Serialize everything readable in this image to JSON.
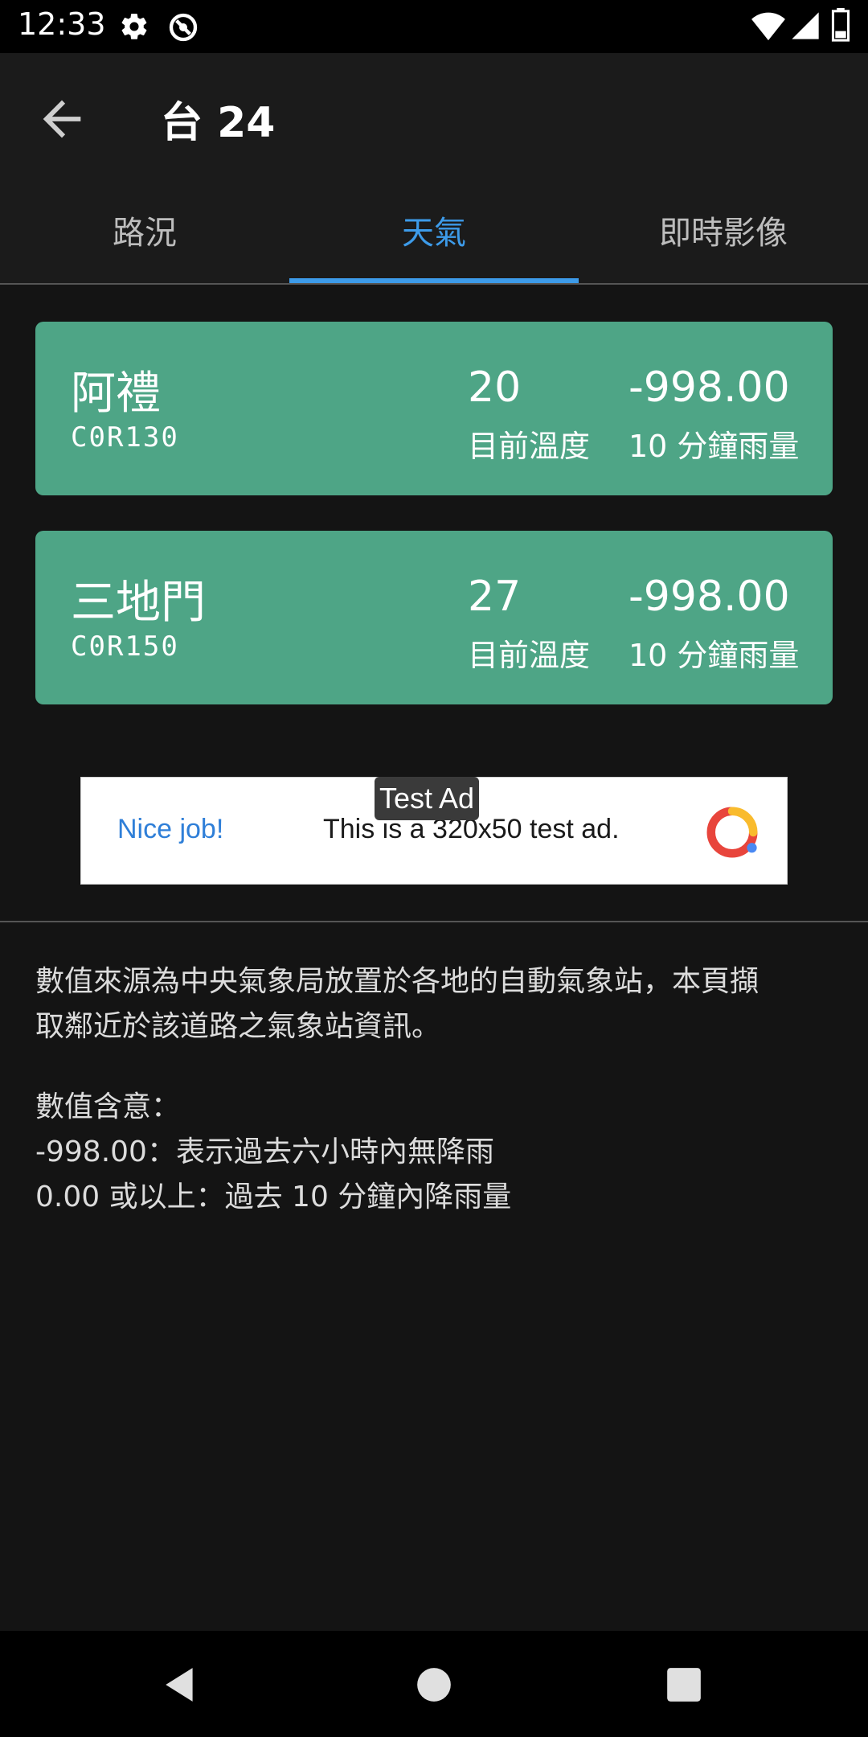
{
  "status_bar": {
    "time": "12:33",
    "icons": [
      "gear-icon",
      "vpn-icon",
      "wifi-icon",
      "signal-icon",
      "battery-icon"
    ]
  },
  "app_bar": {
    "title": "台 24",
    "back_icon": "arrow-back-icon"
  },
  "tabs": [
    {
      "label": "路況",
      "active": false
    },
    {
      "label": "天氣",
      "active": true
    },
    {
      "label": "即時影像",
      "active": false
    }
  ],
  "stations": [
    {
      "name": "阿禮",
      "id": "C0R130",
      "temp": "20",
      "temp_label": "目前溫度",
      "rain": "-998.00",
      "rain_label": "10 分鐘雨量"
    },
    {
      "name": "三地門",
      "id": "C0R150",
      "temp": "27",
      "temp_label": "目前溫度",
      "rain": "-998.00",
      "rain_label": "10 分鐘雨量"
    }
  ],
  "ad": {
    "badge": "Test Ad",
    "nice": "Nice job!",
    "text": "This is a 320x50 test ad."
  },
  "info": {
    "source_line1": "數值來源為中央氣象局放置於各地的自動氣象站，本頁擷",
    "source_line2": "取鄰近於該道路之氣象站資訊。",
    "meaning_title": "數值含意：",
    "meaning_1": "-998.00：表示過去六小時內無降雨",
    "meaning_2": "0.00 或以上：過去 10 分鐘內降雨量"
  },
  "nav_bar": {
    "icons": [
      "back-triangle-icon",
      "home-circle-icon",
      "recents-square-icon"
    ]
  },
  "colors": {
    "accent": "#3d9be9",
    "card": "#4ea586",
    "background": "#141414"
  }
}
